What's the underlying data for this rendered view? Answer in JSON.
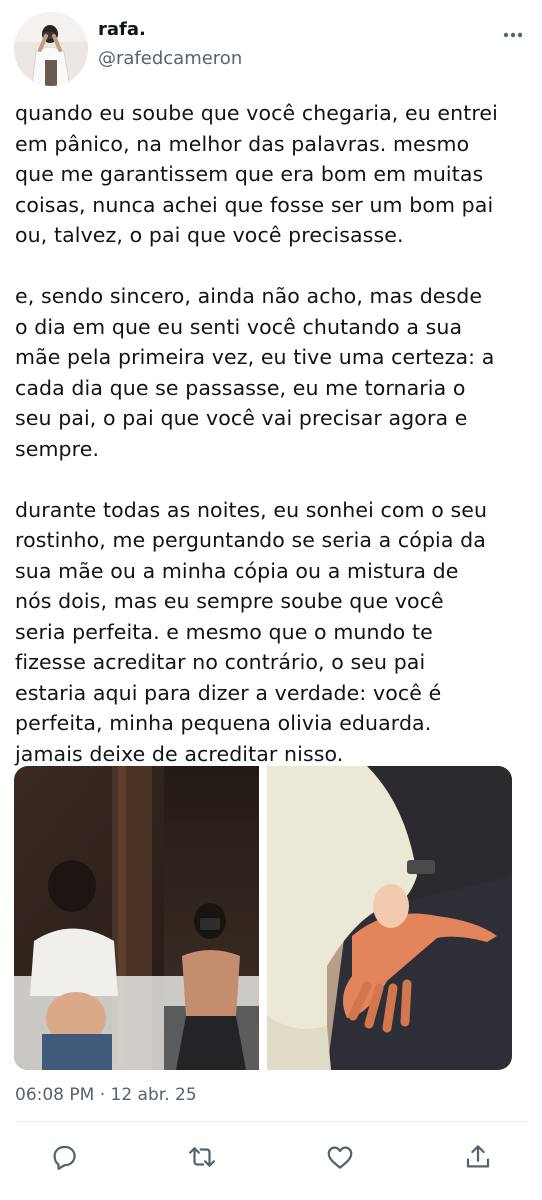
{
  "author": {
    "name": "rafa.",
    "handle": "@rafedcameron"
  },
  "tweet": {
    "paragraphs": [
      "quando eu soube que você chegaria, eu entrei\nem pânico, na melhor das palavras. mesmo\nque me garantissem que era bom em muitas\ncoisas, nunca achei que fosse ser um bom pai\nou, talvez, o pai que você precisasse.",
      "e, sendo sincero, ainda não acho, mas desde\no dia em que eu senti você chutando a sua\nmãe pela primeira vez, eu tive uma certeza: a\ncada dia que se passasse, eu me tornaria o\nseu pai, o pai que você vai precisar agora e\nsempre.",
      "durante todas as noites, eu sonhei com o seu\nrostinho, me perguntando se seria a cópia da\nsua mãe ou a minha cópia ou a mistura de\nnós dois, mas eu sempre soube que você\nseria perfeita. e mesmo que o mundo te\nfizesse acreditar no contrário, o seu pai\nestaria aqui para dizer a verdade: você é\nperfeita, minha pequena olivia eduarda.\njamais deixe de acreditar nisso."
    ],
    "timestamp": "06:08 PM · 12 abr. 25"
  },
  "media": [
    {
      "icon": "photo-mirror-selfie"
    },
    {
      "icon": "photo-baby-hand"
    }
  ],
  "icons": {
    "more": "more-icon",
    "reply": "reply-icon",
    "retweet": "retweet-icon",
    "like": "heart-icon",
    "share": "share-icon"
  },
  "colors": {
    "text": "#0f1419",
    "secondary": "#536471",
    "divider": "#e6ecf0"
  }
}
